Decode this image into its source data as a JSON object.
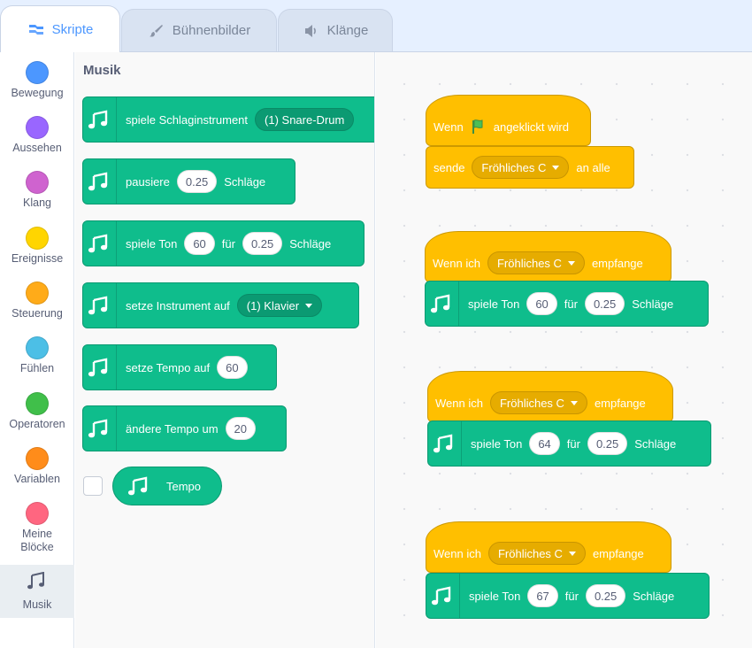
{
  "tabs": [
    {
      "label": "Skripte",
      "icon": "code-icon",
      "active": true
    },
    {
      "label": "Bühnenbilder",
      "icon": "brush-icon",
      "active": false
    },
    {
      "label": "Klänge",
      "icon": "sound-icon",
      "active": false
    }
  ],
  "categories": [
    {
      "label": "Bewegung",
      "color": "#4c97ff"
    },
    {
      "label": "Aussehen",
      "color": "#9966ff"
    },
    {
      "label": "Klang",
      "color": "#cf63cf"
    },
    {
      "label": "Ereignisse",
      "color": "#ffd500"
    },
    {
      "label": "Steuerung",
      "color": "#ffab19"
    },
    {
      "label": "Fühlen",
      "color": "#4cbfe6"
    },
    {
      "label": "Operatoren",
      "color": "#40bf4a"
    },
    {
      "label": "Variablen",
      "color": "#ff8c1a"
    },
    {
      "label": "Meine Blöcke",
      "color": "#ff6680"
    },
    {
      "label": "Musik",
      "icon": "music-notes-icon",
      "selected": true
    }
  ],
  "flyout": {
    "title": "Musik",
    "blocks": {
      "play_drum": {
        "text": "spiele Schlaginstrument",
        "drum": "(1) Snare-Drum"
      },
      "rest": {
        "text": "pausiere",
        "beats": "0.25",
        "unit": "Schläge"
      },
      "play_note": {
        "text": "spiele Ton",
        "note": "60",
        "for": "für",
        "beats": "0.25",
        "unit": "Schläge"
      },
      "set_instrument": {
        "text": "setze Instrument auf",
        "instrument": "(1) Klavier"
      },
      "set_tempo": {
        "text": "setze Tempo auf",
        "value": "60"
      },
      "change_tempo": {
        "text": "ändere Tempo um",
        "value": "20"
      },
      "tempo_reporter": {
        "text": "Tempo"
      }
    }
  },
  "workspace": {
    "script1": {
      "hat_when": "Wenn",
      "hat_clicked": "angeklickt wird",
      "broadcast": "sende",
      "message": "Fröhliches C",
      "to_all": "an alle"
    },
    "scripts": [
      {
        "when": "Wenn ich",
        "message": "Fröhliches C",
        "receive": "empfange",
        "play": "spiele Ton",
        "note": "60",
        "for": "für",
        "beats": "0.25",
        "unit": "Schläge"
      },
      {
        "when": "Wenn ich",
        "message": "Fröhliches C",
        "receive": "empfange",
        "play": "spiele Ton",
        "note": "64",
        "for": "für",
        "beats": "0.25",
        "unit": "Schläge"
      },
      {
        "when": "Wenn ich",
        "message": "Fröhliches C",
        "receive": "empfange",
        "play": "spiele Ton",
        "note": "67",
        "for": "für",
        "beats": "0.25",
        "unit": "Schläge"
      }
    ]
  },
  "colors": {
    "music": "#0fbd8c",
    "events": "#ffbf00",
    "accent": "#4c97ff",
    "flag": "#4cbf56"
  }
}
